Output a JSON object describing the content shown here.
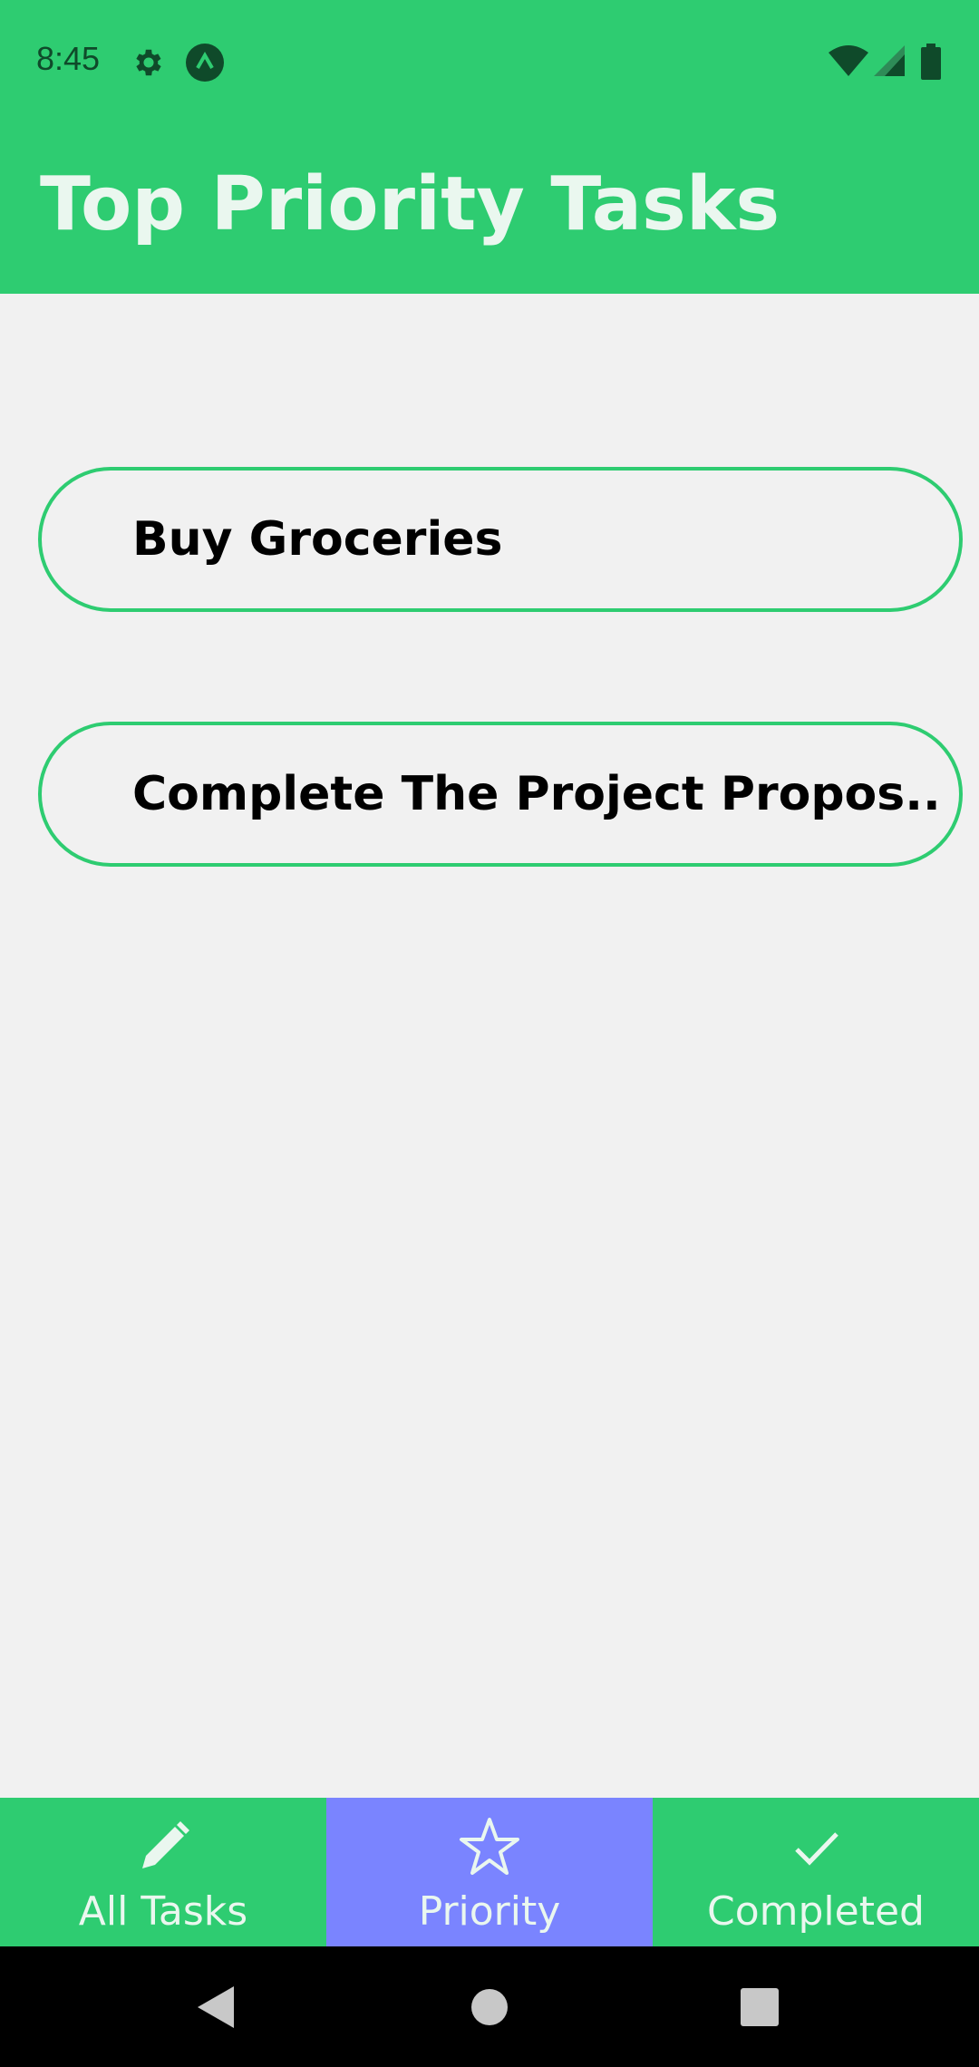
{
  "status_bar": {
    "time": "8:45",
    "icons": [
      "gear-icon",
      "app-notification-icon",
      "wifi-icon",
      "signal-icon",
      "battery-icon"
    ]
  },
  "header": {
    "title": "Top Priority Tasks"
  },
  "tasks": [
    {
      "label": "Buy Groceries"
    },
    {
      "label": "Complete The Project Propos.."
    }
  ],
  "bottom_nav": {
    "items": [
      {
        "label": "All Tasks",
        "icon": "pencil-icon",
        "active": false
      },
      {
        "label": "Priority",
        "icon": "star-icon",
        "active": true
      },
      {
        "label": "Completed",
        "icon": "checkmark-icon",
        "active": false
      }
    ]
  },
  "system_nav": {
    "icons": [
      "back-icon",
      "home-icon",
      "recents-icon"
    ]
  },
  "colors": {
    "accent": "#2ECC71",
    "active_tab": "#7A84FF",
    "background": "#F1F1F1",
    "header_text": "#EAF7EF"
  }
}
